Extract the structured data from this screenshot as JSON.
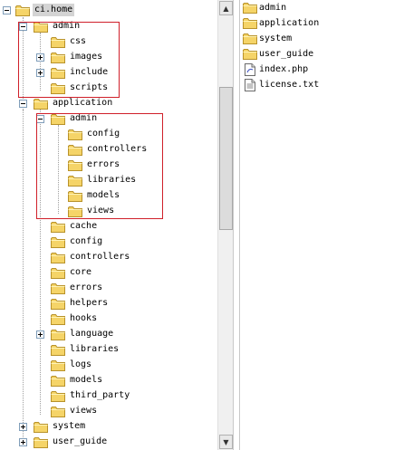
{
  "tree": {
    "items": [
      {
        "label": "ci.home",
        "toggle": "minus",
        "selected": true
      },
      {
        "label": "admin",
        "toggle": "minus"
      },
      {
        "label": "css",
        "toggle": ""
      },
      {
        "label": "images",
        "toggle": "plus"
      },
      {
        "label": "include",
        "toggle": "plus"
      },
      {
        "label": "scripts",
        "toggle": ""
      },
      {
        "label": "application",
        "toggle": "minus"
      },
      {
        "label": "admin",
        "toggle": "minus"
      },
      {
        "label": "config",
        "toggle": ""
      },
      {
        "label": "controllers",
        "toggle": ""
      },
      {
        "label": "errors",
        "toggle": ""
      },
      {
        "label": "libraries",
        "toggle": ""
      },
      {
        "label": "models",
        "toggle": ""
      },
      {
        "label": "views",
        "toggle": ""
      },
      {
        "label": "cache",
        "toggle": ""
      },
      {
        "label": "config",
        "toggle": ""
      },
      {
        "label": "controllers",
        "toggle": ""
      },
      {
        "label": "core",
        "toggle": ""
      },
      {
        "label": "errors",
        "toggle": ""
      },
      {
        "label": "helpers",
        "toggle": ""
      },
      {
        "label": "hooks",
        "toggle": ""
      },
      {
        "label": "language",
        "toggle": "plus"
      },
      {
        "label": "libraries",
        "toggle": ""
      },
      {
        "label": "logs",
        "toggle": ""
      },
      {
        "label": "models",
        "toggle": ""
      },
      {
        "label": "third_party",
        "toggle": ""
      },
      {
        "label": "views",
        "toggle": ""
      },
      {
        "label": "system",
        "toggle": "plus"
      },
      {
        "label": "user_guide",
        "toggle": "plus"
      }
    ]
  },
  "list": {
    "items": [
      {
        "label": "admin",
        "icon": "folder-icon"
      },
      {
        "label": "application",
        "icon": "folder-icon"
      },
      {
        "label": "system",
        "icon": "folder-icon"
      },
      {
        "label": "user_guide",
        "icon": "folder-icon"
      },
      {
        "label": "index.php",
        "icon": "php-file-icon"
      },
      {
        "label": "license.txt",
        "icon": "text-file-icon"
      }
    ]
  },
  "colors": {
    "folder_fill": "#f5d468",
    "folder_stroke": "#b8922a",
    "highlight_border": "#d0202a",
    "selection_bg": "#d4d4d4"
  }
}
